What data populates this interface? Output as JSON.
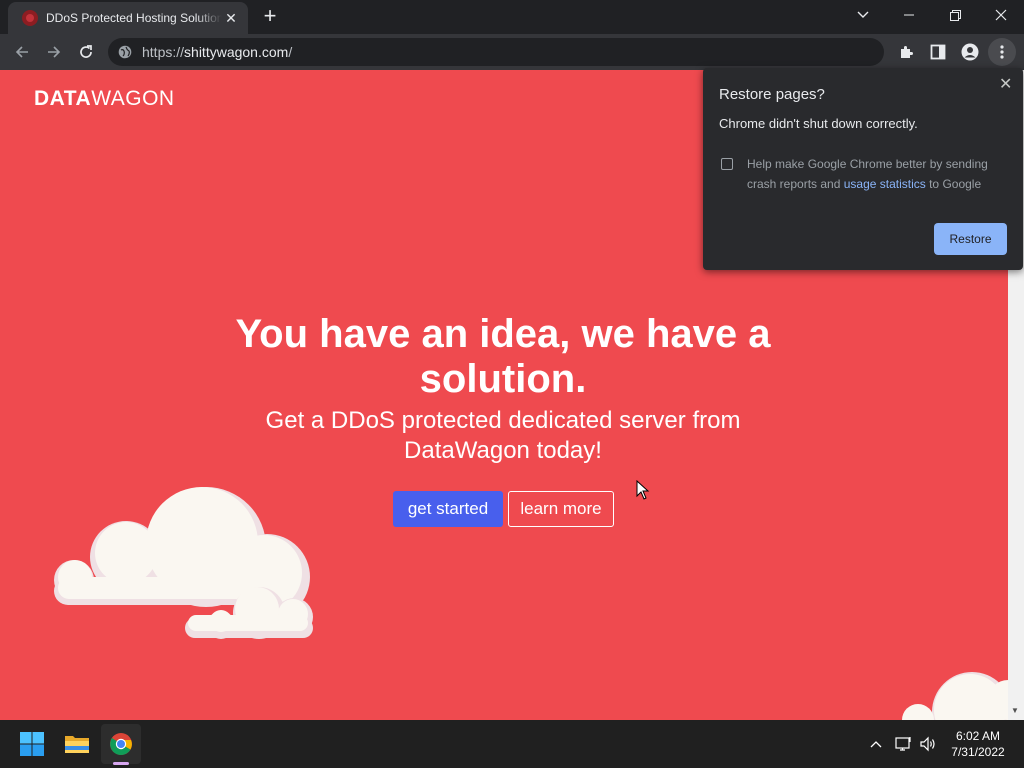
{
  "browser": {
    "tab": {
      "title": "DDoS Protected Hosting Solution",
      "close": "✕"
    },
    "new_tab": "+",
    "url": {
      "scheme": "https://",
      "host": "shittywagon.com",
      "path": "/"
    }
  },
  "page": {
    "logo": {
      "bold": "DATA",
      "light": "WAGON"
    },
    "headline": "You have an idea, we have a solution.",
    "subheadline": "Get a DDoS protected dedicated server from DataWagon today!",
    "buttons": {
      "primary": "get started",
      "secondary": "learn more"
    },
    "colors": {
      "background": "#ef4a4f",
      "primary_button": "#485fed"
    }
  },
  "popup": {
    "title": "Restore pages?",
    "message": "Chrome didn't shut down correctly.",
    "help_prefix": "Help make Google Chrome better by sending crash reports and ",
    "help_link": "usage statistics",
    "help_suffix": " to Google",
    "checkbox_checked": false,
    "restore_label": "Restore",
    "close": "✕"
  },
  "taskbar": {
    "time": "6:02 AM",
    "date": "7/31/2022"
  }
}
